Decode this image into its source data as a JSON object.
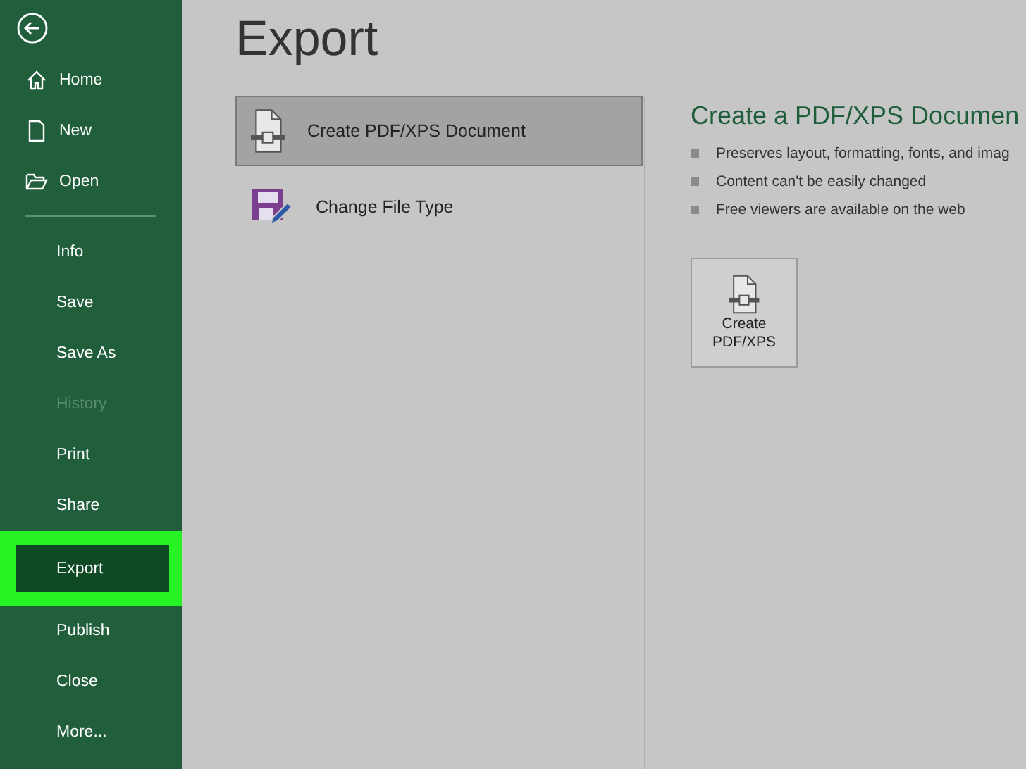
{
  "sidebar": {
    "top_items": [
      {
        "label": "Home"
      },
      {
        "label": "New"
      },
      {
        "label": "Open"
      }
    ],
    "items": [
      {
        "label": "Info",
        "selected": false,
        "disabled": false
      },
      {
        "label": "Save",
        "selected": false,
        "disabled": false
      },
      {
        "label": "Save As",
        "selected": false,
        "disabled": false
      },
      {
        "label": "History",
        "selected": false,
        "disabled": true
      },
      {
        "label": "Print",
        "selected": false,
        "disabled": false
      },
      {
        "label": "Share",
        "selected": false,
        "disabled": false
      },
      {
        "label": "Export",
        "selected": true,
        "disabled": false
      },
      {
        "label": "Publish",
        "selected": false,
        "disabled": false
      },
      {
        "label": "Close",
        "selected": false,
        "disabled": false
      },
      {
        "label": "More...",
        "selected": false,
        "disabled": false
      }
    ]
  },
  "page_title": "Export",
  "options": [
    {
      "label": "Create PDF/XPS Document",
      "selected": true
    },
    {
      "label": "Change File Type",
      "selected": false
    }
  ],
  "detail": {
    "title": "Create a PDF/XPS Documen",
    "bullets": [
      "Preserves layout, formatting, fonts, and imag",
      "Content can't be easily changed",
      "Free viewers are available on the web"
    ],
    "button_lines": [
      "Create",
      "PDF/XPS"
    ]
  }
}
